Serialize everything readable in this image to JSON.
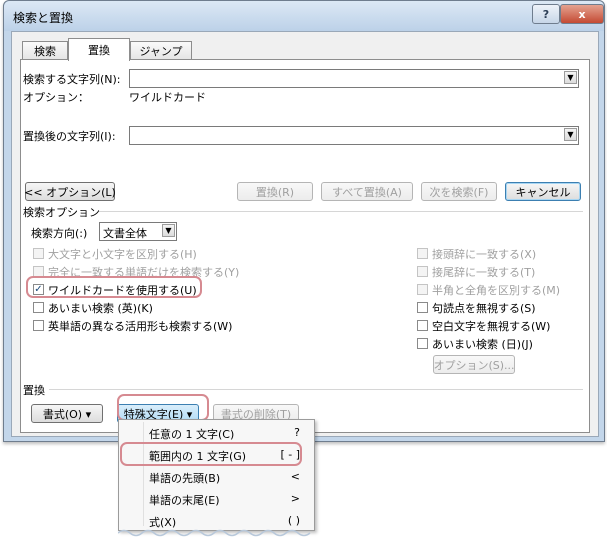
{
  "window": {
    "title": "検索と置換",
    "help_glyph": "?",
    "close_glyph": "x"
  },
  "tabs": [
    {
      "label": "検索",
      "active": false
    },
    {
      "label": "置換",
      "active": true
    },
    {
      "label": "ジャンプ",
      "active": false
    }
  ],
  "find": {
    "label": "検索する文字列(N):",
    "value": "",
    "options_label": "オプション：",
    "options_value": "ワイルドカード"
  },
  "replace": {
    "label": "置換後の文字列(I):",
    "value": ""
  },
  "buttons": {
    "less_options": "<< オプション(L)",
    "replace": "置換(R)",
    "replace_all": "すべて置換(A)",
    "find_next": "次を検索(F)",
    "cancel": "キャンセル",
    "format": "書式(O) ▾",
    "special": "特殊文字(E) ▾",
    "no_formatting": "書式の削除(T)",
    "options": "オプション(S)..."
  },
  "search_options": {
    "heading": "検索オプション",
    "direction_label": "検索方向(:)",
    "direction_value": "文書全体",
    "left_checks": [
      {
        "label": "大文字と小文字を区別する(H)",
        "checked": false,
        "enabled": false
      },
      {
        "label": "完全に一致する単語だけを検索する(Y)",
        "checked": false,
        "enabled": false
      },
      {
        "label": "ワイルドカードを使用する(U)",
        "checked": true,
        "enabled": true
      },
      {
        "label": "あいまい検索 (英)(K)",
        "checked": false,
        "enabled": true
      },
      {
        "label": "英単語の異なる活用形も検索する(W)",
        "checked": false,
        "enabled": true
      }
    ],
    "right_checks": [
      {
        "label": "接頭辞に一致する(X)",
        "checked": false,
        "enabled": false
      },
      {
        "label": "接尾辞に一致する(T)",
        "checked": false,
        "enabled": false
      },
      {
        "label": "半角と全角を区別する(M)",
        "checked": false,
        "enabled": false
      },
      {
        "label": "句読点を無視する(S)",
        "checked": false,
        "enabled": true
      },
      {
        "label": "空白文字を無視する(W)",
        "checked": false,
        "enabled": true
      },
      {
        "label": "あいまい検索 (日)(J)",
        "checked": false,
        "enabled": true
      }
    ]
  },
  "replace_section": {
    "heading": "置換"
  },
  "special_menu": {
    "items": [
      {
        "label": "任意の 1 文字(C)",
        "shortcut": "?",
        "highlighted": false
      },
      {
        "label": "範囲内の 1 文字(G)",
        "shortcut": "[ - ]",
        "highlighted": true
      },
      {
        "label": "単語の先頭(B)",
        "shortcut": "<",
        "highlighted": false
      },
      {
        "label": "単語の末尾(E)",
        "shortcut": ">",
        "highlighted": false
      },
      {
        "label": "式(X)",
        "shortcut": "( )",
        "highlighted": false
      }
    ]
  },
  "colors": {
    "highlight_outline": "#d68a91",
    "accent": "#3c7fb1"
  }
}
